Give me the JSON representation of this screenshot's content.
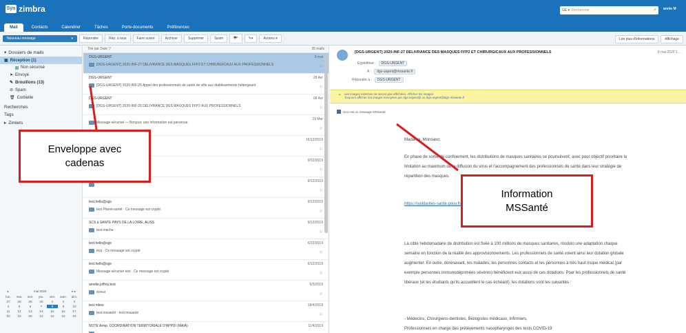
{
  "app": {
    "logo": "zimbra",
    "logo_mark": "Syn",
    "user": "annie M"
  },
  "search": {
    "scope": "GE ▾",
    "placeholder": "Rechercher"
  },
  "apptabs": [
    "Mail",
    "Contacts",
    "Calendrier",
    "Tâches",
    "Porte-documents",
    "Préférences"
  ],
  "toolbar": {
    "new_message": "Nouveau message",
    "buttons": [
      "Répondre",
      "Rép. à tous",
      "Faire suivre",
      "Archiver",
      "Supprimer",
      "Spam"
    ],
    "actions": "Actions ▾",
    "right": [
      "Lire plus d'informations",
      "Affichage"
    ]
  },
  "sidebar": {
    "mail_folders": "Dossiers de mails",
    "items": [
      "Réception (1)",
      "Non sécurisé",
      "Envoyé",
      "Brouillons (13)",
      "Spam",
      "Corbeille"
    ],
    "searches": "Recherches",
    "tags": "Tags",
    "zimlets": "Zimlets"
  },
  "minical": {
    "month": "mai 2020",
    "days": [
      "lun.",
      "mar.",
      "mer.",
      "jeu.",
      "ven.",
      "sam.",
      "dim."
    ],
    "dates": [
      "27",
      "28",
      "29",
      "30",
      "1",
      "2",
      "3",
      "4",
      "5",
      "6",
      "7",
      "8",
      "9",
      "10",
      "11",
      "12",
      "13",
      "14",
      "15",
      "16",
      "17",
      "18",
      "19",
      "20",
      "21",
      "22",
      "23",
      "24"
    ],
    "today_index": 11
  },
  "list": {
    "sort": "Trié par Date ▽",
    "count": "35 mails",
    "messages": [
      {
        "from": "DGS-URGENT",
        "subject": "[DGS-URGENT] 2020-INF-27 DELIVRANCE DES MASQUES FFP2 ET CHIRURGICAUX AUX PROFESSIONNELS",
        "date": "8 mai",
        "selected": true
      },
      {
        "from": "DGS-URGENT",
        "subject": "[DGS-URGENT] 2020-INF-26 Appel des professionnels de santé de ville aux établissements hébergeant",
        "date": "28 Avr",
        "selected": false
      },
      {
        "from": "DGS-URGENT",
        "subject": "[DGS-URGENT] 2020-INF-25 DELIVRANCE DES MASQUES FFP2 AUX PROFESSIONNELS",
        "date": "06 Avr",
        "selected": false
      },
      {
        "from": "",
        "subject": "Message sécurisé — Bonjour, une information est parvenue",
        "date": "19 Mar",
        "selected": false
      },
      {
        "from": "",
        "subject": "",
        "date": "16/12/2019",
        "selected": false
      },
      {
        "from": "",
        "subject": "",
        "date": "9/12/2019",
        "selected": false
      },
      {
        "from": "",
        "subject": "",
        "date": "9/12/2019",
        "selected": false
      },
      {
        "from": "test.hello@sgs",
        "subject": "test Planet-santé · Ce message est crypté",
        "date": "9/12/2019",
        "selected": false
      },
      {
        "from": "SCS à SANTE PAYS DE LA LOIRE, ALISS",
        "subject": "test macha",
        "date": "9/12/2019",
        "selected": false
      },
      {
        "from": "test.hello@sgs",
        "subject": "test · Ce message est crypté",
        "date": "6/12/2019",
        "selected": false
      },
      {
        "from": "test.hello@sgs",
        "subject": "Message sécurisé test · Ce message est crypté",
        "date": "6/12/2019",
        "selected": false
      },
      {
        "from": "amelie.joffroy.test",
        "subject": "erreur",
        "date": "6/5/2019",
        "selected": false
      },
      {
        "from": "test mbox",
        "subject": "test mssanté · test mssanté",
        "date": "18/4/2019",
        "selected": false
      },
      {
        "from": "NOTE Armp. COORDINATION TERRITORIALE D'APPUI (MAIA)",
        "subject": "",
        "date": "11/4/2019",
        "selected": false
      }
    ]
  },
  "reading": {
    "subject": "[DGS-URGENT] 2020-INF-27 DELIVRANCE DES MASQUES FFP2 ET CHIRURGICAUX AUX PROFESSIONNELS",
    "date": "8 mai 2020 1...",
    "from_label": "Expéditeur :",
    "from": "DGS-URGENT",
    "to_label": "À :",
    "to": "dgs-urgent@mssante.fr",
    "reply_label": "Répondre à :",
    "reply_to": "DGS-URGENT",
    "warning_line1": "Les images externes ne seront pas affichées.",
    "warning_link1": "Afficher les images",
    "warning_line2": "Toujours afficher les images envoyées par dgs-urgent@ ou dgs-urgent@dgs-mssante.fr",
    "mss_notice": "Ceci est un message MSSanté",
    "body": [
      "Madame, Monsieur,",
      "En phase de sortie de confinement, les distributions de masques sanitaires se poursuivent, avec pour objectif prioritaire la limitation au maximum de la diffusion du virus et l'accompagnement des professionnels de santé dans leur stratégie de répartition des masques.",
      "https://solidarites-sante.gouv.fr/...",
      "La cible hebdomadaire de distribution est fixée à 100 millions de masques sanitaires, modulo une adaptation chaque semaine en fonction de la réalité des approvisionnements. Les professionnels de santé voient ainsi leur dotation globale augmenter. En outre, dorénavant, les malades, les personnes contacts et les personnes à très haut risque médical (par exemple personnes immunodéprimées sévères) bénéficient eux aussi de ces dotations. Pour les professionnels de santé libéraux (et les étudiants qu'ils accueillent le cas échéant), les dotations sont les suivantes :",
      "- Médecins, Chirurgiens-dentistes, Biologistes médicaux, Infirmiers,",
      "Professionnels en charge des prélèvements nasopharyngés des tests COVID-19"
    ]
  },
  "annotations": {
    "envelope": [
      "Enveloppe avec",
      "cadenas"
    ],
    "mssante": [
      "Information",
      "MSSanté"
    ]
  },
  "colors": {
    "brand": "#1a73ba",
    "annotation": "#d91c1c",
    "selected_row": "#a9c9e6",
    "warning_bg": "#fbf4a3"
  }
}
